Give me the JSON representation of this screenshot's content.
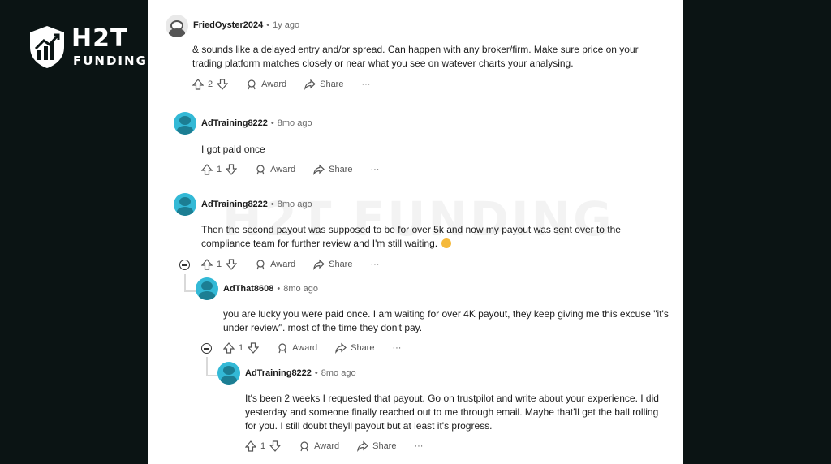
{
  "brand": {
    "name": "H2T",
    "tagline": "FUNDING",
    "watermark": "H2T FUNDING"
  },
  "actions": {
    "award": "Award",
    "share": "Share",
    "more": "···"
  },
  "comments": [
    {
      "user": "FriedOyster2024",
      "age": "1y ago",
      "text": "& sounds like a delayed entry and/or spread. Can happen with any broker/firm. Make sure price on your trading platform matches closely or near what you see on watever charts your analysing.",
      "votes": "2"
    },
    {
      "user": "AdTraining8222",
      "age": "8mo ago",
      "text": "I got paid once",
      "votes": "1"
    },
    {
      "user": "AdTraining8222",
      "age": "8mo ago",
      "text": "Then the second payout was supposed to be for over 5k and now my payout was sent over to the compliance team for further review and I'm still waiting.",
      "votes": "1"
    },
    {
      "user": "AdThat8608",
      "age": "8mo ago",
      "text": "you are lucky you were paid once. I am waiting for over 4K payout, they keep giving me this excuse \"it's under review\". most of the time they don't pay.",
      "votes": "1"
    },
    {
      "user": "AdTraining8222",
      "age": "8mo ago",
      "text": "It's been 2 weeks I requested that payout. Go on trustpilot and write about your experience. I did yesterday and someone finally reached out to me through email. Maybe that'll get the ball rolling for you. I still doubt theyll payout but at least it's progress.",
      "votes": "1"
    }
  ]
}
